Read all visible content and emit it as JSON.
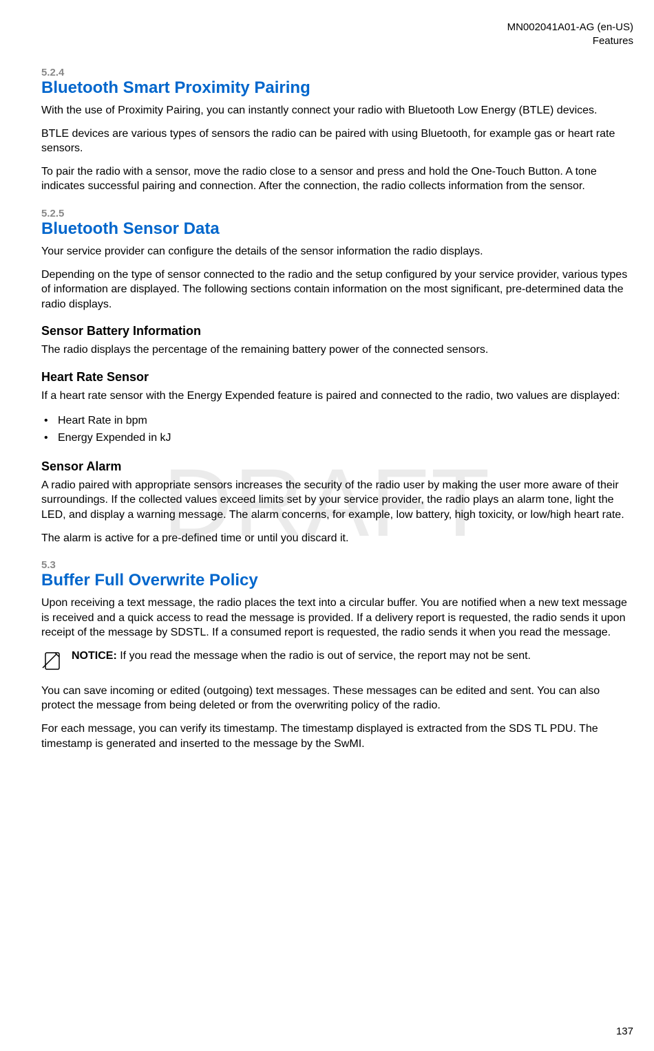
{
  "header": {
    "doc_id": "MN002041A01-AG (en-US)",
    "section": "Features"
  },
  "watermark": "DRAFT",
  "sections": {
    "s524": {
      "num": "5.2.4",
      "title": "Bluetooth Smart Proximity Pairing",
      "p1": "With the use of Proximity Pairing, you can instantly connect your radio with Bluetooth Low Energy (BTLE) devices.",
      "p2": "BTLE devices are various types of sensors the radio can be paired with using Bluetooth, for example gas or heart rate sensors.",
      "p3": "To pair the radio with a sensor, move the radio close to a sensor and press and hold the One-Touch Button. A tone indicates successful pairing and connection. After the connection, the radio collects information from the sensor."
    },
    "s525": {
      "num": "5.2.5",
      "title": "Bluetooth Sensor Data",
      "p1": "Your service provider can configure the details of the sensor information the radio displays.",
      "p2": "Depending on the type of sensor connected to the radio and the setup configured by your service provider, various types of information are displayed. The following sections contain information on the most significant, pre-determined data the radio displays.",
      "sub1_title": "Sensor Battery Information",
      "sub1_p1": "The radio displays the percentage of the remaining battery power of the connected sensors.",
      "sub2_title": "Heart Rate Sensor",
      "sub2_p1": "If a heart rate sensor with the Energy Expended feature is paired and connected to the radio, two values are displayed:",
      "sub2_li1": "Heart Rate in bpm",
      "sub2_li2": "Energy Expended in kJ",
      "sub3_title": "Sensor Alarm",
      "sub3_p1": "A radio paired with appropriate sensors increases the security of the radio user by making the user more aware of their surroundings. If the collected values exceed limits set by your service provider, the radio plays an alarm tone, light the LED, and display a warning message. The alarm concerns, for example, low battery, high toxicity, or low/high heart rate.",
      "sub3_p2": "The alarm is active for a pre-defined time or until you discard it."
    },
    "s53": {
      "num": "5.3",
      "title": "Buffer Full Overwrite Policy",
      "p1": "Upon receiving a text message, the radio places the text into a circular buffer. You are notified when a new text message is received and a quick access to read the message is provided. If a delivery report is requested, the radio sends it upon receipt of the message by SDSTL. If a consumed report is requested, the radio sends it when you read the message.",
      "notice_label": "NOTICE:",
      "notice_text": " If you read the message when the radio is out of service, the report may not be sent.",
      "p2": "You can save incoming or edited (outgoing) text messages. These messages can be edited and sent. You can also protect the message from being deleted or from the overwriting policy of the radio.",
      "p3": "For each message, you can verify its timestamp. The timestamp displayed is extracted from the SDS TL PDU. The timestamp is generated and inserted to the message by the SwMI."
    }
  },
  "page_number": "137"
}
